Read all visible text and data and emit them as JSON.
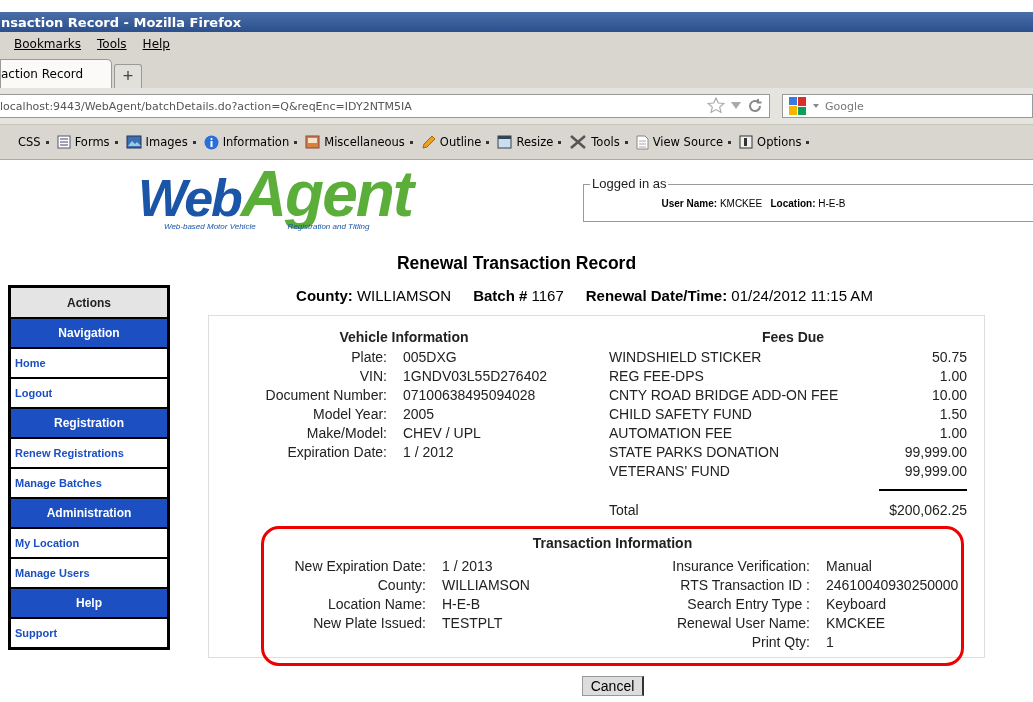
{
  "window": {
    "title": "nsaction Record - Mozilla Firefox"
  },
  "menu": [
    "Bookmarks",
    "Tools",
    "Help"
  ],
  "tabs": [
    {
      "label": "action Record",
      "selected": true
    }
  ],
  "new_tab": "+",
  "address_bar": {
    "value": "localhost:9443/WebAgent/batchDetails.do?action=Q&reqEnc=IDY2NTM5IA"
  },
  "search_bar": {
    "placeholder": "Google"
  },
  "toolbar": [
    {
      "label": "CSS"
    },
    {
      "label": "Forms"
    },
    {
      "label": "Images"
    },
    {
      "label": "Information"
    },
    {
      "label": "Miscellaneous"
    },
    {
      "label": "Outline"
    },
    {
      "label": "Resize"
    },
    {
      "label": "Tools"
    },
    {
      "label": "View Source"
    },
    {
      "label": "Options"
    }
  ],
  "logo": {
    "word_1": "Web",
    "word_2": "Agent",
    "tagline_1": "Web-based Motor Vehicle",
    "tagline_2": "Registration and Titling"
  },
  "login": {
    "legend": "Logged in as",
    "user_label": "User Name:",
    "user": "KMCKEE",
    "location_label": "Location:",
    "location": "H-E-B"
  },
  "heading": "Renewal Transaction Record",
  "sidebar": [
    {
      "label": "Actions",
      "kind": "header"
    },
    {
      "label": "Navigation",
      "kind": "section"
    },
    {
      "label": "Home",
      "kind": "link"
    },
    {
      "label": "Logout",
      "kind": "link"
    },
    {
      "label": "Registration",
      "kind": "section"
    },
    {
      "label": "Renew Registrations",
      "kind": "link"
    },
    {
      "label": "Manage Batches",
      "kind": "link"
    },
    {
      "label": "Administration",
      "kind": "section"
    },
    {
      "label": "My Location",
      "kind": "link"
    },
    {
      "label": "Manage Users",
      "kind": "link"
    },
    {
      "label": "Help",
      "kind": "section"
    },
    {
      "label": "Support",
      "kind": "link"
    }
  ],
  "summary": [
    {
      "label": "County:",
      "value": "WILLIAMSON"
    },
    {
      "label": "Batch #",
      "value": "1167"
    },
    {
      "label": "Renewal Date/Time:",
      "value": "01/24/2012 11:15 AM"
    }
  ],
  "vehicle": {
    "title": "Vehicle Information",
    "rows": [
      {
        "label": "Plate:",
        "value": "005DXG"
      },
      {
        "label": "VIN:",
        "value": "1GNDV03L55D276402"
      },
      {
        "label": "Document Number:",
        "value": "07100638495094028"
      },
      {
        "label": "Model Year:",
        "value": "2005"
      },
      {
        "label": "Make/Model:",
        "value": "CHEV / UPL"
      },
      {
        "label": "Expiration Date:",
        "value": "1 / 2012"
      }
    ]
  },
  "fees": {
    "title": "Fees Due",
    "rows": [
      {
        "label": "WINDSHIELD STICKER",
        "value": "50.75"
      },
      {
        "label": "REG FEE-DPS",
        "value": "1.00"
      },
      {
        "label": "CNTY ROAD BRIDGE ADD-ON FEE",
        "value": "10.00"
      },
      {
        "label": "CHILD SAFETY FUND",
        "value": "1.50"
      },
      {
        "label": "AUTOMATION FEE",
        "value": "1.00"
      },
      {
        "label": "STATE PARKS DONATION",
        "value": "99,999.00"
      },
      {
        "label": "VETERANS' FUND",
        "value": "99,999.00"
      }
    ],
    "total_label": "Total",
    "total": "$200,062.25"
  },
  "transaction": {
    "title": "Transaction Information",
    "left": [
      {
        "label": "New Expiration Date:",
        "value": "1 / 2013"
      },
      {
        "label": "County:",
        "value": "WILLIAMSON"
      },
      {
        "label": "Location Name:",
        "value": "H-E-B"
      },
      {
        "label": "New Plate Issued:",
        "value": "TESTPLT"
      }
    ],
    "right": [
      {
        "label": "Insurance Verification:",
        "value": "Manual"
      },
      {
        "label": "RTS Transaction ID :",
        "value": "24610040930250000"
      },
      {
        "label": "Search Entry Type :",
        "value": "Keyboard"
      },
      {
        "label": "Renewal User Name:",
        "value": "KMCKEE"
      },
      {
        "label": "Print Qty:",
        "value": "1"
      }
    ]
  },
  "cancel_button": "Cancel"
}
